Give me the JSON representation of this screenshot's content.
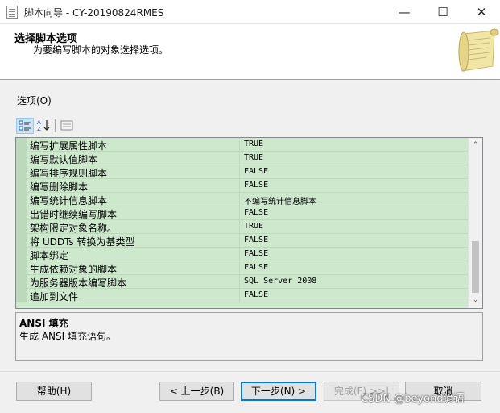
{
  "window": {
    "title": "脚本向导 - CY-20190824RMES",
    "minimize": "—",
    "maximize": "☐",
    "close": "✕"
  },
  "header": {
    "title": "选择脚本选项",
    "subtitle": "为要编写脚本的对象选择选项。"
  },
  "options_label": "选项(O)",
  "toolbar": {
    "categorized_icon": "categorized-icon",
    "alphabetical_icon": "sort-az-icon",
    "property_pages_icon": "property-pages-icon"
  },
  "grid": {
    "rows": [
      {
        "name": "编写扩展属性脚本",
        "value": "TRUE"
      },
      {
        "name": "编写默认值脚本",
        "value": "TRUE"
      },
      {
        "name": "编写排序规则脚本",
        "value": "FALSE"
      },
      {
        "name": "编写删除脚本",
        "value": "FALSE"
      },
      {
        "name": "编写统计信息脚本",
        "value": "不编写统计信息脚本"
      },
      {
        "name": "出错时继续编写脚本",
        "value": "FALSE"
      },
      {
        "name": "架构限定对象名称。",
        "value": "TRUE"
      },
      {
        "name": "将 UDDTs 转换为基类型",
        "value": "FALSE"
      },
      {
        "name": "脚本绑定",
        "value": "FALSE"
      },
      {
        "name": "生成依赖对象的脚本",
        "value": "FALSE"
      },
      {
        "name": "为服务器版本编写脚本",
        "value": "SQL Server 2008"
      },
      {
        "name": "追加到文件",
        "value": "FALSE"
      }
    ],
    "scroll_up": "⌃",
    "scroll_down": "⌄"
  },
  "description": {
    "title": "ANSI 填充",
    "text": "生成 ANSI 填充语句。"
  },
  "buttons": {
    "help": "帮助(H)",
    "back": "< 上一步(B)",
    "next": "下一步(N) >",
    "finish": "完成(F) >>|",
    "cancel": "取消"
  },
  "watermark": "CSDN @beyond谚语",
  "colors": {
    "grid_bg": "#cde8cd",
    "accent": "#0078d7"
  }
}
